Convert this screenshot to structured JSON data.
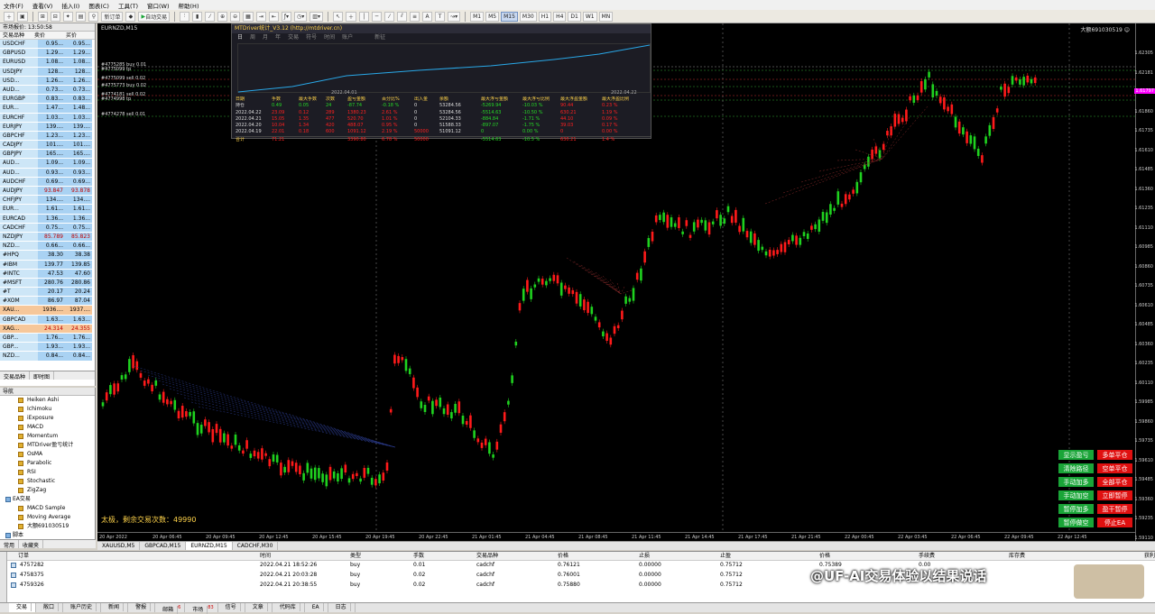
{
  "menu": [
    "文件(F)",
    "查看(V)",
    "插入(I)",
    "图表(C)",
    "工具(T)",
    "窗口(W)",
    "帮助(H)"
  ],
  "toolbar": {
    "new_order": "新订单",
    "auto_trading": "自动交易",
    "timeframes": [
      "M1",
      "M5",
      "M15",
      "M30",
      "H1",
      "H4",
      "D1",
      "W1",
      "MN"
    ],
    "active_timeframe": "M15"
  },
  "market_watch": {
    "title": "市场报价: 13:50:58",
    "headers": [
      "交易品种",
      "卖价",
      "买价"
    ],
    "rows": [
      {
        "sym": "USDCHF",
        "bid": "0.95...",
        "ask": "0.95..."
      },
      {
        "sym": "GBPUSD",
        "bid": "1.29...",
        "ask": "1.29..."
      },
      {
        "sym": "EURUSD",
        "bid": "1.08...",
        "ask": "1.08..."
      },
      {
        "sym": "USDJPY",
        "bid": "128...",
        "ask": "128..."
      },
      {
        "sym": "USD...",
        "bid": "1.26...",
        "ask": "1.26..."
      },
      {
        "sym": "AUD...",
        "bid": "0.73...",
        "ask": "0.73..."
      },
      {
        "sym": "EURGBP",
        "bid": "0.83...",
        "ask": "0.83..."
      },
      {
        "sym": "EUR...",
        "bid": "1.47...",
        "ask": "1.48..."
      },
      {
        "sym": "EURCHF",
        "bid": "1.03...",
        "ask": "1.03..."
      },
      {
        "sym": "EURJPY",
        "bid": "139....",
        "ask": "139...."
      },
      {
        "sym": "GBPCHF",
        "bid": "1.23...",
        "ask": "1.23..."
      },
      {
        "sym": "CADJPY",
        "bid": "101....",
        "ask": "101...."
      },
      {
        "sym": "GBPJPY",
        "bid": "165....",
        "ask": "165...."
      },
      {
        "sym": "AUD...",
        "bid": "1.09...",
        "ask": "1.09..."
      },
      {
        "sym": "AUD...",
        "bid": "0.93...",
        "ask": "0.93..."
      },
      {
        "sym": "AUDCHF",
        "bid": "0.69...",
        "ask": "0.69..."
      },
      {
        "sym": "AUDJPY",
        "bid": "93.847",
        "ask": "93.878"
      },
      {
        "sym": "CHFJPY",
        "bid": "134....",
        "ask": "134...."
      },
      {
        "sym": "EUR...",
        "bid": "1.61...",
        "ask": "1.61..."
      },
      {
        "sym": "EURCAD",
        "bid": "1.36...",
        "ask": "1.36..."
      },
      {
        "sym": "CADCHF",
        "bid": "0.75...",
        "ask": "0.75..."
      },
      {
        "sym": "NZDJPY",
        "bid": "85.789",
        "ask": "85.823"
      },
      {
        "sym": "NZD...",
        "bid": "0.66...",
        "ask": "0.66..."
      },
      {
        "sym": "#HPQ",
        "bid": "38.30",
        "ask": "38.38"
      },
      {
        "sym": "#IBM",
        "bid": "139.77",
        "ask": "139.85"
      },
      {
        "sym": "#INTC",
        "bid": "47.53",
        "ask": "47.60"
      },
      {
        "sym": "#MSFT",
        "bid": "280.76",
        "ask": "280.86"
      },
      {
        "sym": "#T",
        "bid": "20.17",
        "ask": "20.24"
      },
      {
        "sym": "#XOM",
        "bid": "86.97",
        "ask": "87.04"
      },
      {
        "sym": "XAU...",
        "bid": "1936....",
        "ask": "1937...."
      },
      {
        "sym": "GBPCAD",
        "bid": "1.63...",
        "ask": "1.63..."
      },
      {
        "sym": "XAG...",
        "bid": "24.314",
        "ask": "24.355"
      },
      {
        "sym": "GBP...",
        "bid": "1.76...",
        "ask": "1.76..."
      },
      {
        "sym": "GBP...",
        "bid": "1.93...",
        "ask": "1.93..."
      },
      {
        "sym": "NZD...",
        "bid": "0.84...",
        "ask": "0.84..."
      }
    ],
    "tabs": [
      "交易品种",
      "即时图"
    ]
  },
  "navigator": {
    "title": "导航",
    "items": [
      {
        "label": "Heiken Ashi",
        "group": false
      },
      {
        "label": "Ichimoku",
        "group": false
      },
      {
        "label": "iExposure",
        "group": false
      },
      {
        "label": "MACD",
        "group": false
      },
      {
        "label": "Momentum",
        "group": false
      },
      {
        "label": "MTDriver盈亏统计",
        "group": false
      },
      {
        "label": "OsMA",
        "group": false
      },
      {
        "label": "Parabolic",
        "group": false
      },
      {
        "label": "RSI",
        "group": false
      },
      {
        "label": "Stochastic",
        "group": false
      },
      {
        "label": "ZigZag",
        "group": false
      },
      {
        "label": "EA交易",
        "group": true
      },
      {
        "label": "MACD Sample",
        "group": false
      },
      {
        "label": "Moving Average",
        "group": false
      },
      {
        "label": "大额691030519",
        "group": false
      },
      {
        "label": "脚本",
        "group": true
      }
    ],
    "tabs": [
      "常用",
      "收藏夹"
    ]
  },
  "chart": {
    "title": "EURNZD,M15",
    "right_label": "大额691030519 ☺",
    "status_text": "太极，剩余交易次数：49990",
    "order_labels": [
      "#4775285 buy 0.01",
      "#4775099 tp",
      "#4775099 sell 0.02",
      "#4775773 buy 0.02",
      "#4774181 sell 0.02",
      "#4774998 tp",
      "#4774278 sell 0.01"
    ],
    "price_ticks": [
      "1.62305",
      "1.62181",
      "1.61987",
      "1.61860",
      "1.61735",
      "1.61610",
      "1.61485",
      "1.61360",
      "1.61235",
      "1.61110",
      "1.60985",
      "1.60860",
      "1.60735",
      "1.60610",
      "1.60485",
      "1.60360",
      "1.60235",
      "1.60110",
      "1.59985",
      "1.59860",
      "1.59735",
      "1.59610",
      "1.59485",
      "1.59360",
      "1.59235",
      "1.59110"
    ],
    "current_price": "1.61797",
    "time_ticks": [
      "20 Apr 2022",
      "20 Apr 06:45",
      "20 Apr 09:45",
      "20 Apr 12:45",
      "20 Apr 15:45",
      "20 Apr 19:45",
      "20 Apr 22:45",
      "21 Apr 01:45",
      "21 Apr 04:45",
      "21 Apr 08:45",
      "21 Apr 11:45",
      "21 Apr 14:45",
      "21 Apr 17:45",
      "21 Apr 21:45",
      "22 Apr 00:45",
      "22 Apr 03:45",
      "22 Apr 06:45",
      "22 Apr 09:45",
      "22 Apr 12:45"
    ]
  },
  "stats_panel": {
    "title": "MTDriver统计_V3.12 (http://mtdriver.cn)",
    "tabs": [
      "日",
      "周",
      "月",
      "年",
      "交易",
      "符号",
      "时间",
      "账户",
      "",
      "",
      "新征"
    ],
    "date_left": "2022.04.01",
    "date_right": "2022.04.22",
    "headers": [
      "日期",
      "手数",
      "最大手数",
      "次数",
      "盈亏金额",
      "百分比%",
      "出入金",
      "余额",
      "最大浮亏金额",
      "最大浮亏比例",
      "最大浮盈金额",
      "最大浮盈比例"
    ],
    "rows": [
      [
        "持仓",
        "0.49",
        "0.05",
        "24",
        "-87.74",
        "-0.18 %",
        "0",
        "53284.56",
        "-5269.94",
        "-10.03 %",
        "90.44",
        "0.23 %"
      ],
      [
        "2022.04.22",
        "23.09",
        "0.12",
        "289",
        "1380.23",
        "2.61 %",
        "0",
        "53284.56",
        "-5514.63",
        "-10.50 %",
        "630.21",
        "1.19 %"
      ],
      [
        "2022.04.21",
        "15.05",
        "1.35",
        "477",
        "520.70",
        "1.01 %",
        "0",
        "52104.33",
        "-884.84",
        "-1.71 %",
        "44.10",
        "0.09 %"
      ],
      [
        "2022.04.20",
        "10.04",
        "1.34",
        "420",
        "488.07",
        "0.95 %",
        "0",
        "51588.33",
        "-897.07",
        "-1.75 %",
        "39.03",
        "0.17 %"
      ],
      [
        "2022.04.19",
        "22.01",
        "0.18",
        "600",
        "1091.12",
        "2.19 %",
        "50000",
        "51091.12",
        "0",
        "0.00 %",
        "0",
        "0.00 %"
      ],
      [
        "合计",
        "71.21",
        "",
        "",
        "3390.80",
        "6.78 %",
        "50000",
        "",
        "-5514.63",
        "-10.5 %",
        "630.21",
        "1.4 %"
      ]
    ]
  },
  "ea_buttons": [
    {
      "label": "显示盈亏",
      "color": "g"
    },
    {
      "label": "多单平仓",
      "color": "r"
    },
    {
      "label": "清除路径",
      "color": "g"
    },
    {
      "label": "空单平仓",
      "color": "r"
    },
    {
      "label": "手动加多",
      "color": "g"
    },
    {
      "label": "全部平仓",
      "color": "r"
    },
    {
      "label": "手动加空",
      "color": "g"
    },
    {
      "label": "立即暂停",
      "color": "r"
    },
    {
      "label": "暂停加多",
      "color": "g"
    },
    {
      "label": "盈干暂停",
      "color": "r"
    },
    {
      "label": "暂停做空",
      "color": "g"
    },
    {
      "label": "停止EA",
      "color": "r"
    }
  ],
  "chart_tabs": [
    "XAUUSD,M5",
    "GBPCAD,M15",
    "EURNZD,M15",
    "CADCHF,M30"
  ],
  "active_chart_tab": "EURNZD,M15",
  "terminal": {
    "headers": [
      "订单",
      "时间",
      "类型",
      "手数",
      "交易品种",
      "价格",
      "止损",
      "止盈",
      "价格",
      "手续费",
      "库存费",
      "获利"
    ],
    "rows": [
      [
        "4757282",
        "2022.04.21 18:52:26",
        "buy",
        "0.01",
        "cadchf",
        "0.76121",
        "0.00000",
        "0.75712",
        "0.75389",
        "0.00",
        "",
        ""
      ],
      [
        "4758375",
        "2022.04.21 20:03:28",
        "buy",
        "0.02",
        "cadchf",
        "0.76001",
        "0.00000",
        "0.75712",
        "",
        "",
        "",
        ""
      ],
      [
        "4759326",
        "2022.04.21 20:38:55",
        "buy",
        "0.02",
        "cadchf",
        "0.75880",
        "0.00000",
        "0.75712",
        "",
        "",
        "",
        ""
      ]
    ],
    "tabs": [
      "交易",
      "敞口",
      "账户历史",
      "新闻",
      "警报",
      "邮箱",
      "市场",
      "信号",
      "文章",
      "代码库",
      "EA",
      "日志"
    ],
    "mailbox_badge": "6",
    "market_badge": "83"
  },
  "watermark": "@UF-AI交易体验以结果说话",
  "colors": {
    "bull": "#1fd21f",
    "bear": "#ff1a1a",
    "line": "#29a8e8",
    "accent": "#ffd34a"
  }
}
